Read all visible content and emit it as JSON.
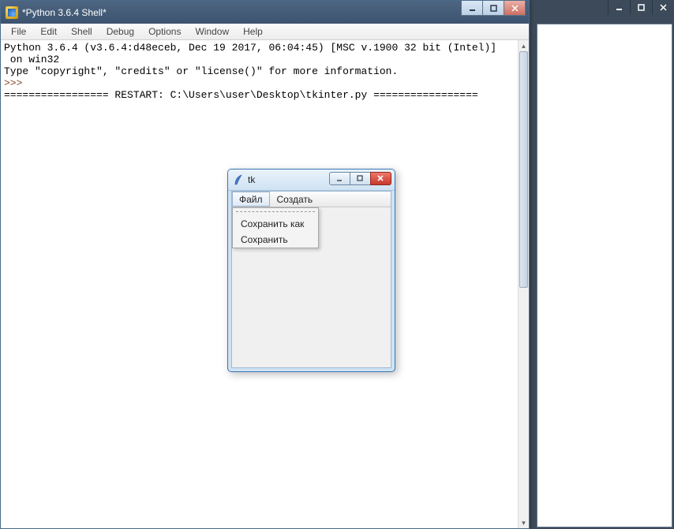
{
  "outer_controls": {
    "min": "—",
    "max": "▭",
    "close": "×"
  },
  "shell": {
    "title": "*Python 3.6.4 Shell*",
    "menu": [
      "File",
      "Edit",
      "Shell",
      "Debug",
      "Options",
      "Window",
      "Help"
    ],
    "line1": "Python 3.6.4 (v3.6.4:d48eceb, Dec 19 2017, 06:04:45) [MSC v.1900 32 bit (Intel)]",
    "line2": " on win32",
    "line3": "Type \"copyright\", \"credits\" or \"license()\" for more information.",
    "prompt": ">>> ",
    "restart": "================= RESTART: C:\\Users\\user\\Desktop\\tkinter.py ================="
  },
  "tk": {
    "title": "tk",
    "menu": {
      "file": "Файл",
      "create": "Создать"
    },
    "dropdown": {
      "save_as": "Сохранить как",
      "save": "Сохранить"
    }
  }
}
